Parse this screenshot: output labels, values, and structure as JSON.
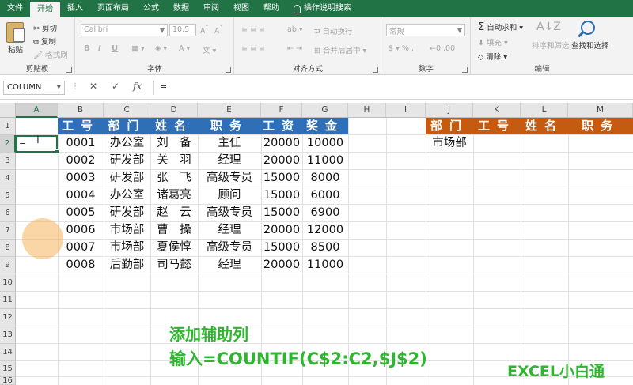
{
  "ribbon_tabs": [
    "文件",
    "开始",
    "插入",
    "页面布局",
    "公式",
    "数据",
    "审阅",
    "视图",
    "帮助",
    "操作说明搜索"
  ],
  "clipboard": {
    "paste": "粘贴",
    "cut": "剪切",
    "copy": "复制",
    "format_painter": "格式刷",
    "label": "剪贴板"
  },
  "font": {
    "name": "Calibri",
    "size": "10.5",
    "bold": "B",
    "italic": "I",
    "underline": "U",
    "label": "字体"
  },
  "alignment": {
    "wrap": "自动换行",
    "merge": "合并后居中",
    "label": "对齐方式"
  },
  "number": {
    "format": "常规",
    "label": "数字"
  },
  "editing": {
    "autosum": "自动求和",
    "fill": "填充",
    "clear": "清除",
    "sort_filter": "排序和筛选",
    "find_select": "查找和选择",
    "label": "编辑"
  },
  "formula_bar": {
    "name_box": "COLUMN",
    "cancel": "✕",
    "enter": "✓",
    "fx": "fx",
    "content": "="
  },
  "columns": [
    "A",
    "B",
    "C",
    "D",
    "E",
    "F",
    "G",
    "H",
    "I",
    "J",
    "K",
    "L",
    "M"
  ],
  "rows": [
    "1",
    "2",
    "3",
    "4",
    "5",
    "6",
    "7",
    "8",
    "9",
    "10",
    "11",
    "12",
    "13",
    "14",
    "15",
    "16"
  ],
  "table_headers": [
    "工号",
    "部门",
    "姓名",
    "职务",
    "工资",
    "奖金"
  ],
  "table_rows": [
    [
      "0001",
      "办公室",
      "刘　备",
      "主任",
      "20000",
      "10000"
    ],
    [
      "0002",
      "研发部",
      "关　羽",
      "经理",
      "20000",
      "11000"
    ],
    [
      "0003",
      "研发部",
      "张　飞",
      "高级专员",
      "15000",
      "8000"
    ],
    [
      "0004",
      "办公室",
      "诸葛亮",
      "顾问",
      "15000",
      "6000"
    ],
    [
      "0005",
      "研发部",
      "赵　云",
      "高级专员",
      "15000",
      "6900"
    ],
    [
      "0006",
      "市场部",
      "曹　操",
      "经理",
      "20000",
      "12000"
    ],
    [
      "0007",
      "市场部",
      "夏侯惇",
      "高级专员",
      "15000",
      "8500"
    ],
    [
      "0008",
      "后勤部",
      "司马懿",
      "经理",
      "20000",
      "11000"
    ]
  ],
  "lookup_headers": [
    "部门",
    "工号",
    "姓名",
    "职务"
  ],
  "lookup_value": "市场部",
  "active_cell_content": "=",
  "annotation": {
    "line1": "添加辅助列",
    "line2": "输入=COUNTIF(C$2:C2,$J$2)"
  },
  "watermark": "EXCEL小白通",
  "colors": {
    "ribbon": "#217346",
    "header_blue": "#2f6fb8",
    "header_orange": "#c55a11",
    "annotation": "#2fb52f"
  }
}
